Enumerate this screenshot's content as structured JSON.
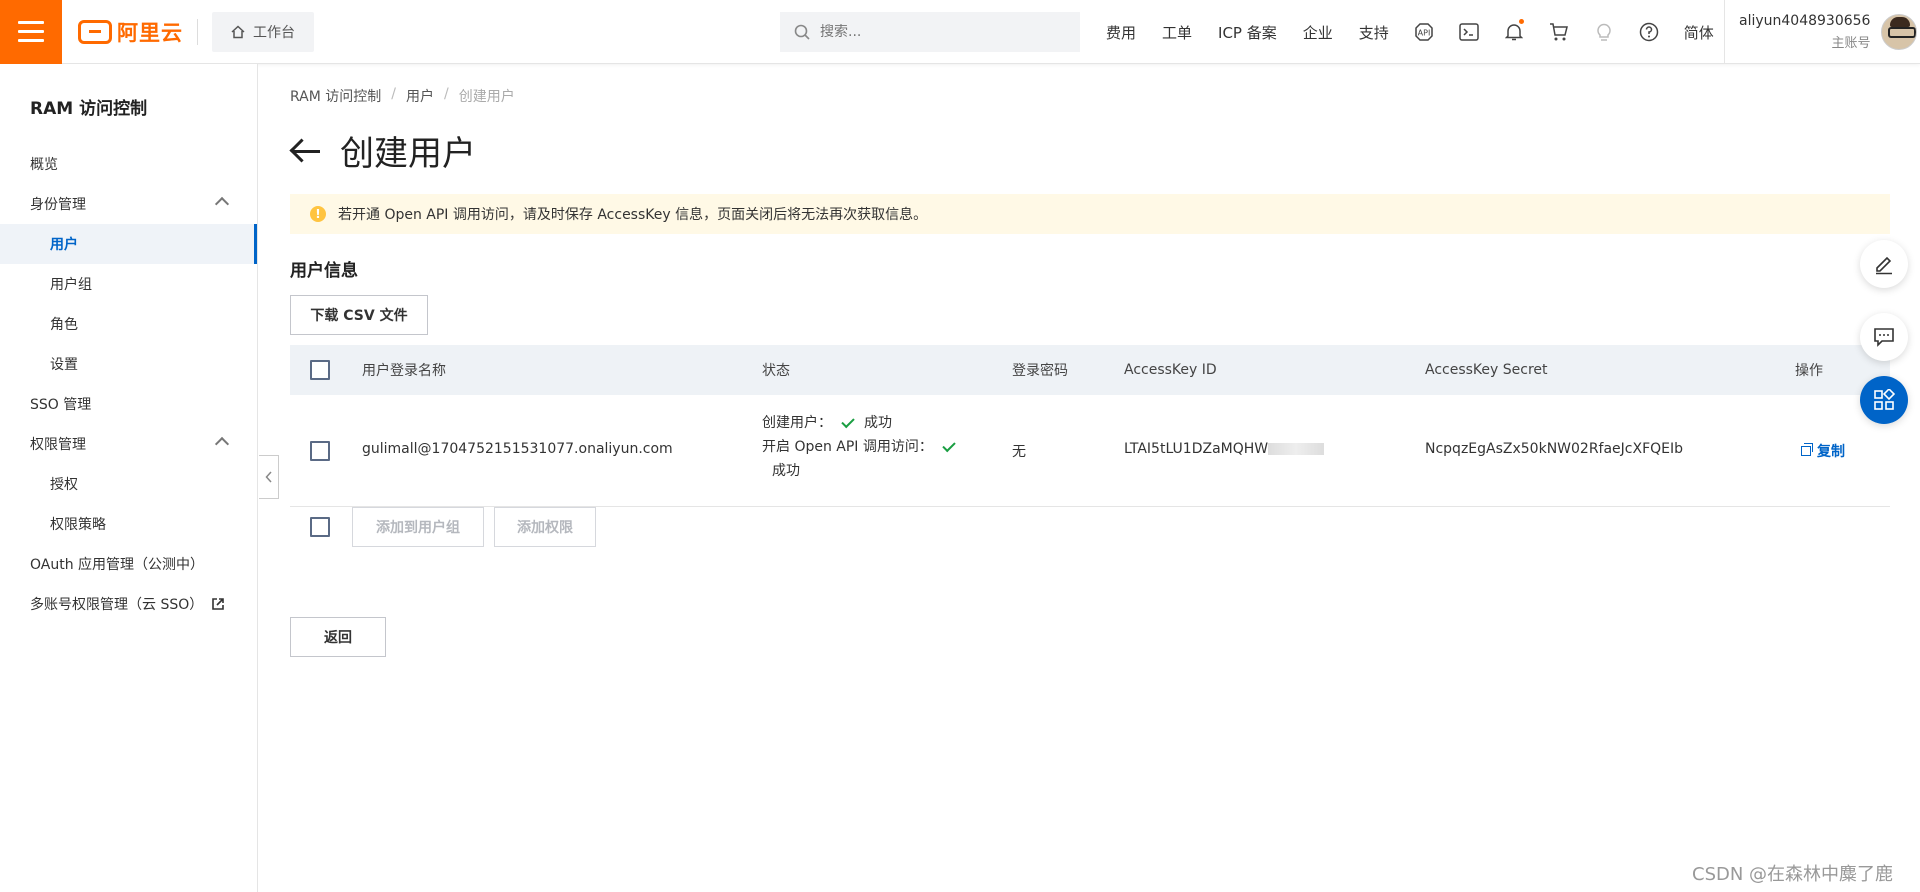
{
  "header": {
    "logo_text": "阿里云",
    "workbench_label": "工作台",
    "search_placeholder": "搜索...",
    "nav_links": [
      "费用",
      "工单",
      "ICP 备案",
      "企业",
      "支持"
    ],
    "language": "简体",
    "user_name": "aliyun4048930656",
    "user_role": "主账号",
    "brand_color": "#ff6a00"
  },
  "sidebar": {
    "title": "RAM 访问控制",
    "items": {
      "overview": "概览",
      "identity": "身份管理",
      "users": "用户",
      "groups": "用户组",
      "roles": "角色",
      "settings": "设置",
      "sso": "SSO 管理",
      "permissions": "权限管理",
      "grant": "授权",
      "policies": "权限策略",
      "oauth": "OAuth 应用管理（公测中）",
      "multi_account": "多账号权限管理（云 SSO）"
    },
    "active_color": "#0064c8"
  },
  "main": {
    "breadcrumb": [
      "RAM 访问控制",
      "用户",
      "创建用户"
    ],
    "title": "创建用户",
    "alert": "若开通 Open API 调用访问，请及时保存 AccessKey 信息，页面关闭后将无法再次获取信息。",
    "section_title": "用户信息",
    "csv_button": "下载 CSV 文件",
    "table": {
      "headers": [
        "用户登录名称",
        "状态",
        "登录密码",
        "AccessKey ID",
        "AccessKey Secret",
        "操作"
      ],
      "row": {
        "login_name": "gulimall@1704752151531077.onaliyun.com",
        "status_create_label": "创建用户：",
        "status_create_value": "成功",
        "status_api_label": "开启 Open API 调用访问：",
        "status_api_value": "成功",
        "password": "无",
        "access_key_id": "LTAI5tLU1DZaMQHW",
        "access_key_secret": "NcpqzEgAsZx50kNW02RfaeJcXFQEIb",
        "action": "复制"
      }
    },
    "bulk": {
      "add_to_group": "添加到用户组",
      "add_permission": "添加权限"
    },
    "back_button": "返回"
  },
  "watermark": "CSDN @在森林中麋了鹿"
}
